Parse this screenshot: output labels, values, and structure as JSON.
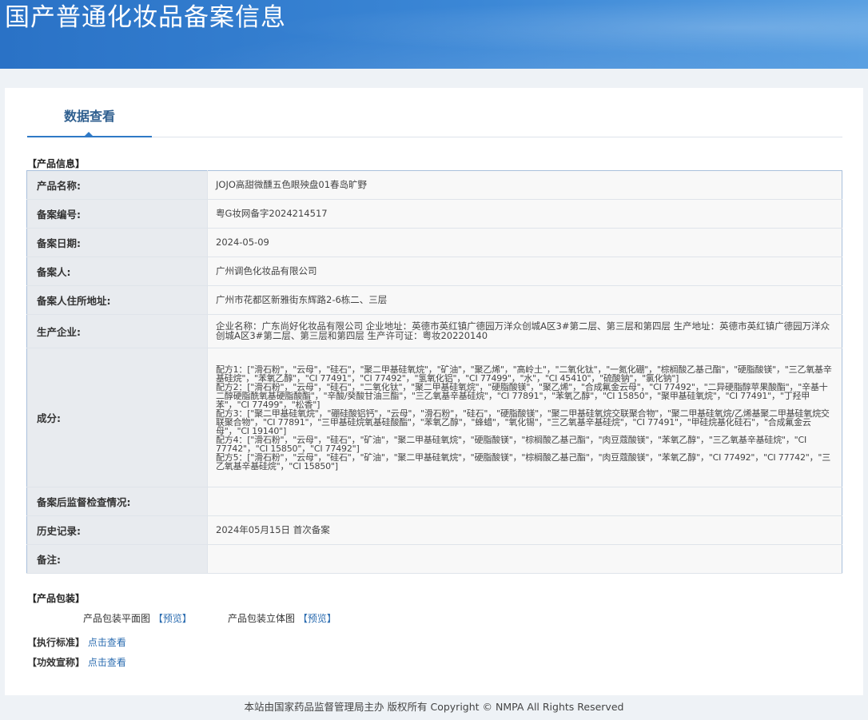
{
  "header": {
    "title": "国产普通化妆品备案信息"
  },
  "tabs": {
    "active": "数据查看"
  },
  "product_info": {
    "section_title": "【产品信息】",
    "rows": [
      {
        "label": "产品名称:",
        "value": "JOJO高甜微醺五色眼殃盘01春岛旷野"
      },
      {
        "label": "备案编号:",
        "value": "粤G妆网备字2024214517"
      },
      {
        "label": "备案日期:",
        "value": "2024-05-09"
      },
      {
        "label": "备案人:",
        "value": "广州调色化妆品有限公司"
      },
      {
        "label": "备案人住所地址:",
        "value": "广州市花都区新雅街东辉路2-6栋二、三层"
      },
      {
        "label": "生产企业:",
        "value": "企业名称：广东尚好化妆品有限公司 企业地址：英德市英红镇广德园万洋众创城A区3#第二层、第三层和第四层 生产地址：英德市英红镇广德园万洋众创城A区3#第二层、第三层和第四层 生产许可证：粤妆20220140"
      },
      {
        "label": "成分:",
        "value": "配方1：[\"滑石粉\"，\"云母\"，\"硅石\"，\"聚二甲基硅氧烷\"，\"矿油\"，\"聚乙烯\"，\"高岭土\"，\"二氧化钛\"，\"一氮化硼\"，\"棕榈酸乙基己酯\"，\"硬脂酸镁\"，\"三乙氧基辛基硅烷\"，\"苯氧乙醇\"，\"CI 77491\"，\"CI 77492\"，\"氢氧化铝\"，\"CI 77499\"，\"水\"，\"CI 45410\"，\"硫酸钠\"，\"氯化钠\"]\n配方2：[\"滑石粉\"，\"云母\"，\"硅石\"，\"二氧化钛\"，\"聚二甲基硅氧烷\"，\"硬脂酸镁\"，\"聚乙烯\"，\"合成氟金云母\"，\"CI 77492\"，\"二异硬脂醇苹果酸酯\"，\"辛基十二醇硬脂酰氧基硬脂酸酯\"，\"辛酸/癸酸甘油三酯\"，\"三乙氧基辛基硅烷\"，\"CI 77891\"，\"苯氧乙醇\"，\"CI 15850\"，\"聚甲基硅氧烷\"，\"CI 77491\"，\"丁羟甲苯\"，\"CI 77499\"，\"松香\"]\n配方3：[\"聚二甲基硅氧烷\"，\"硼硅酸铝钙\"，\"云母\"，\"滑石粉\"，\"硅石\"，\"硬脂酸镁\"，\"聚二甲基硅氧烷交联聚合物\"，\"聚二甲基硅氧烷/乙烯基聚二甲基硅氧烷交联聚合物\"，\"CI 77891\"，\"三甲基硅烷氧基硅酸酯\"，\"苯氧乙醇\"，\"蜂蜡\"，\"氧化锡\"，\"三乙氧基辛基硅烷\"，\"CI 77491\"，\"甲硅烷基化硅石\"，\"合成氟金云母\"，\"CI 19140\"]\n配方4：[\"滑石粉\"，\"云母\"，\"硅石\"，\"矿油\"，\"聚二甲基硅氧烷\"，\"硬脂酸镁\"，\"棕榈酸乙基己酯\"，\"肉豆蔻酸镁\"，\"苯氧乙醇\"，\"三乙氧基辛基硅烷\"，\"CI 77742\"，\"CI 15850\"，\"CI 77492\"]\n配方5：[\"滑石粉\"，\"云母\"，\"硅石\"，\"矿油\"，\"聚二甲基硅氧烷\"，\"硬脂酸镁\"，\"棕榈酸乙基己酯\"，\"肉豆蔻酸镁\"，\"苯氧乙醇\"，\"CI 77492\"，\"CI 77742\"，\"三乙氧基辛基硅烷\"，\"CI 15850\"]"
      },
      {
        "label": "备案后监督检查情况:",
        "value": ""
      },
      {
        "label": "历史记录:",
        "value": "2024年05月15日 首次备案"
      },
      {
        "label": "备注:",
        "value": ""
      }
    ]
  },
  "packaging": {
    "section_title": "【产品包装】",
    "flat_label": "产品包装平面图",
    "flat_link": "【预览】",
    "solid_label": "产品包装立体图",
    "solid_link": "【预览】"
  },
  "standard": {
    "label": "【执行标准】",
    "link": "点击查看"
  },
  "efficacy": {
    "label": "【功效宣称】",
    "link": "点击查看"
  },
  "footer": {
    "text": "本站由国家药品监督管理局主办 版权所有 Copyright © NMPA All Rights Reserved"
  }
}
